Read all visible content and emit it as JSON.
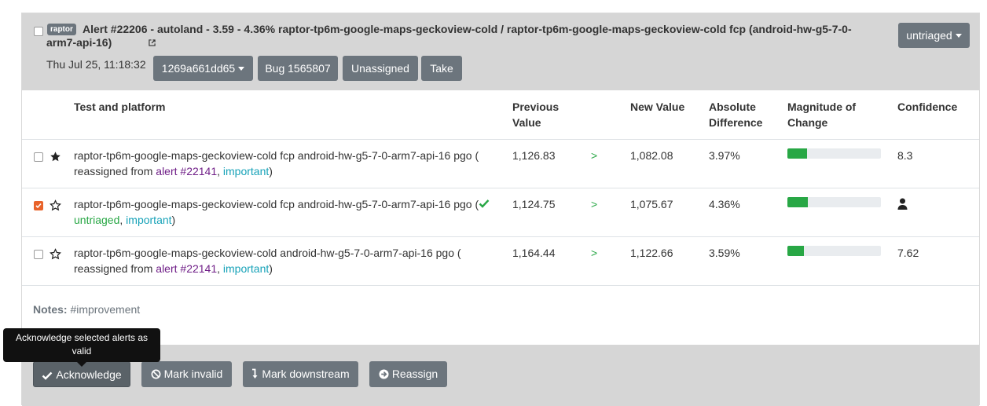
{
  "header": {
    "badge": "raptor",
    "title": "Alert #22206 - autoland - 3.59 - 4.36% raptor-tp6m-google-maps-geckoview-cold / raptor-tp6m-google-maps-geckoview-cold fcp (android-hw-g5-7-0-arm7-api-16)",
    "external_link_icon": "external-link-icon",
    "timestamp": "Thu Jul 25, 11:18:32",
    "revision_label": "1269a661dd65",
    "bug_label": "Bug 1565807",
    "assignee_label": "Unassigned",
    "take_label": "Take",
    "status_dropdown_label": "untriaged"
  },
  "table": {
    "columns": {
      "test": "Test and platform",
      "previous": "Previous Value",
      "new": "New Value",
      "absolute": "Absolute Difference",
      "magnitude": "Magnitude of Change",
      "confidence": "Confidence"
    },
    "rows": [
      {
        "checked": false,
        "starred": true,
        "test": "raptor-tp6m-google-maps-geckoview-cold fcp android-hw-g5-7-0-arm7-api-16 pgo (",
        "reassigned_prefix": "reassigned from ",
        "alert_link": "alert #22141",
        "sep": ", ",
        "tag": "important",
        "close": ")",
        "previous": "1,126.83",
        "arrow": ">",
        "new": "1,082.08",
        "absolute": "3.97%",
        "magnitude_fraction": 0.21,
        "confidence": "8.3"
      },
      {
        "checked": true,
        "starred": false,
        "test": "raptor-tp6m-google-maps-geckoview-cold fcp android-hw-g5-7-0-arm7-api-16 pgo (",
        "status": "untriaged",
        "sep": ", ",
        "tag": "important",
        "close": ")",
        "previous": "1,124.75",
        "arrow": ">",
        "new": "1,075.67",
        "absolute": "4.36%",
        "magnitude_fraction": 0.22,
        "confidence_icon": "user-icon"
      },
      {
        "checked": false,
        "starred": false,
        "test": "raptor-tp6m-google-maps-geckoview-cold android-hw-g5-7-0-arm7-api-16 pgo (",
        "reassigned_prefix": "reassigned from ",
        "alert_link": "alert #22141",
        "sep": ", ",
        "tag": "important",
        "close": ")",
        "previous": "1,164.44",
        "arrow": ">",
        "new": "1,122.66",
        "absolute": "3.59%",
        "magnitude_fraction": 0.18,
        "confidence": "7.62"
      }
    ]
  },
  "notes": {
    "label": "Notes:",
    "value": "#improvement"
  },
  "tooltip": "Acknowledge selected alerts as valid",
  "footer": {
    "acknowledge": "Acknowledge",
    "mark_invalid": "Mark invalid",
    "mark_downstream": "Mark downstream",
    "reassign": "Reassign"
  },
  "colors": {
    "header_bg": "#d6d6d6",
    "button_bg": "#6c757d",
    "success": "#28a745",
    "alert_link": "#6f1e87",
    "tag_link": "#17a2b8",
    "checkbox_checked": "#e8632a"
  }
}
